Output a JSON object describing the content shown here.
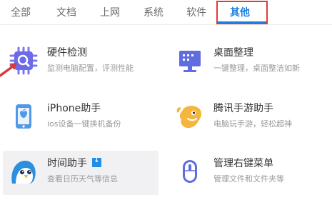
{
  "tabs": [
    {
      "label": "全部",
      "active": false
    },
    {
      "label": "文档",
      "active": false
    },
    {
      "label": "上网",
      "active": false
    },
    {
      "label": "系统",
      "active": false
    },
    {
      "label": "软件",
      "active": false
    },
    {
      "label": "其他",
      "active": true
    }
  ],
  "tools": [
    {
      "title": "硬件检测",
      "desc": "监测电脑配置，评测性能",
      "icon": "chip-search-icon"
    },
    {
      "title": "桌面整理",
      "desc": "一键整理，桌面整洁如新",
      "icon": "desktop-monitor-icon"
    },
    {
      "title": "iPhone助手",
      "desc": "ios设备一键换机备份",
      "icon": "iphone-apple-icon"
    },
    {
      "title": "腾讯手游助手",
      "desc": "电脑玩手游，轻松超神",
      "icon": "game-mascot-icon"
    },
    {
      "title": "时间助手",
      "desc": "查看日历天气等信息",
      "icon": "bird-mascot-icon",
      "badge": "download-badge-icon"
    },
    {
      "title": "管理右键菜单",
      "desc": "管理文件和文件夹等",
      "icon": "mouse-icon"
    }
  ],
  "colors": {
    "accent": "#1a7fe0",
    "highlight_box": "#e23a3a",
    "arrow": "#d93a3a"
  }
}
